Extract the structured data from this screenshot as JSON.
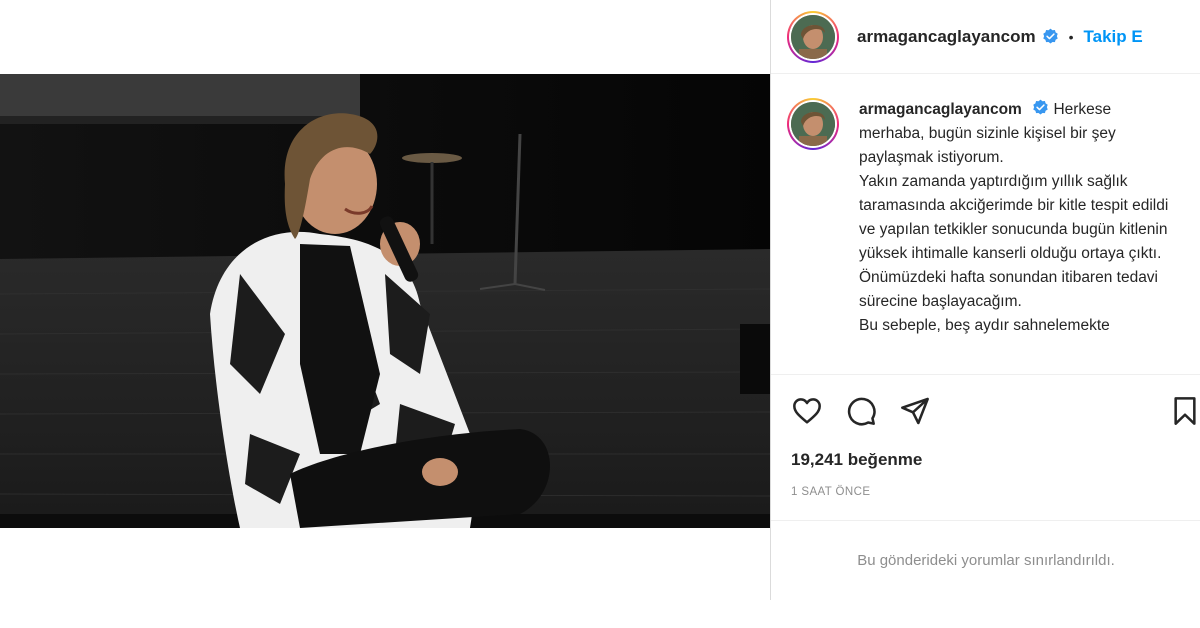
{
  "post": {
    "image_alt": "Performer seated on a dark stage holding a microphone, wearing a black and white patterned outfit"
  },
  "header": {
    "username": "armagancaglayancom",
    "separator": "•",
    "follow_label": "Takip E",
    "verified_icon": "verified-badge-icon"
  },
  "caption": {
    "username": "armagancaglayancom",
    "lines": [
      "Herkese merhaba, bugün sizinle kişisel bir şey paylaşmak istiyorum.",
      "Yakın zamanda yaptırdığım yıllık sağlık taramasında akciğerimde bir kitle tespit edildi ve yapılan tetkikler sonucunda bugün kitlenin yüksek ihtimalle kanserli olduğu ortaya çıktı.",
      "Önümüzdeki hafta sonundan itibaren tedavi sürecine başlayacağım.",
      "Bu sebeple, beş aydır sahnelemekte"
    ]
  },
  "actions": {
    "like_icon": "heart-icon",
    "comment_icon": "comment-icon",
    "share_icon": "paper-plane-icon",
    "save_icon": "bookmark-icon"
  },
  "stats": {
    "likes_text": "19,241 beğenme",
    "time_text": "1 SAAT ÖNCE"
  },
  "comments": {
    "disabled_text": "Bu gönderideki yorumlar sınırlandırıldı."
  },
  "colors": {
    "link_blue": "#0095f6",
    "verified_blue": "#3897f0",
    "muted_gray": "#8e8e8e",
    "border": "#dbdbdb"
  }
}
